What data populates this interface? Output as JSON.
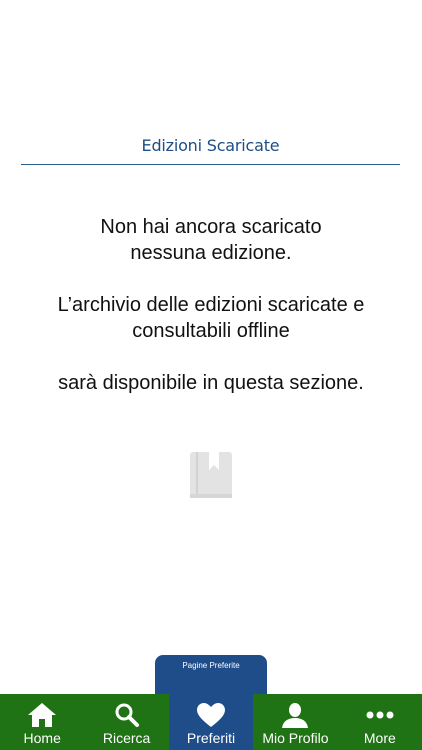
{
  "section": {
    "title": "Edizioni Scaricate"
  },
  "empty_state": {
    "line1": "Non hai ancora scaricato",
    "line2": "nessuna edizione.",
    "line3": "L’archivio delle edizioni scaricate e",
    "line4": "consultabili offline",
    "line5": "sarà disponibile in questa sezione.",
    "icon": "book-bookmark-icon"
  },
  "pages_tab": {
    "label": "Pagine Preferite"
  },
  "tab_bar": {
    "selected": "Preferiti",
    "items": [
      {
        "label": "Home",
        "icon": "home-icon"
      },
      {
        "label": "Ricerca",
        "icon": "search-icon"
      },
      {
        "label": "Preferiti",
        "icon": "heart-icon"
      },
      {
        "label": "Mio Profilo",
        "icon": "user-icon"
      },
      {
        "label": "More",
        "icon": "more-dots-icon"
      }
    ]
  },
  "colors": {
    "title_blue": "#1d4e86",
    "tab_bar_green": "#207314",
    "active_tab_blue": "#1f4d8a",
    "placeholder_icon_gray": "#e3e3e3"
  }
}
